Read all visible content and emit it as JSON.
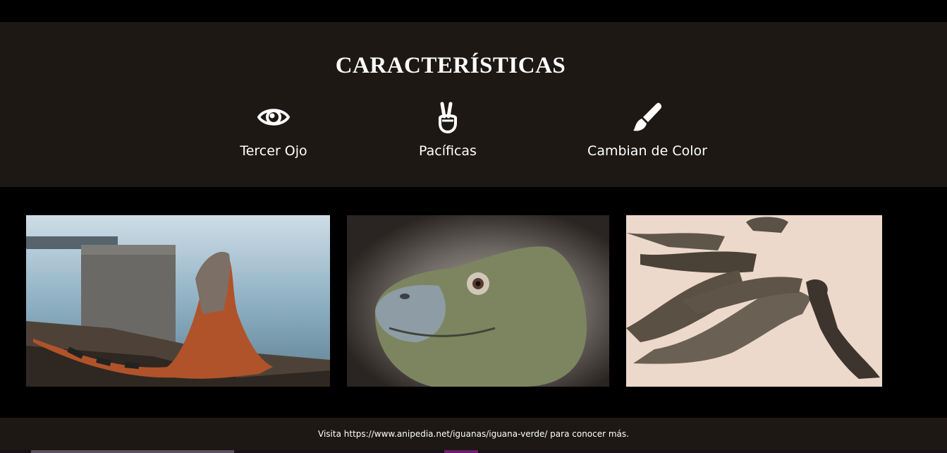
{
  "features": {
    "title": "CARACTERÍSTICAS",
    "items": [
      {
        "icon": "eye-icon",
        "label": "Tercer Ojo"
      },
      {
        "icon": "peace-hand-icon",
        "label": "Pacíficas"
      },
      {
        "icon": "paint-brush-icon",
        "label": "Cambian de Color"
      }
    ]
  },
  "gallery": {
    "images": [
      {
        "alt": "iguana-orange-by-water"
      },
      {
        "alt": "iguana-head-closeup"
      },
      {
        "alt": "iguanas-group-on-sand"
      }
    ]
  },
  "footer": {
    "text": "Visita https://www.anipedia.net/iguanas/iguana-verde/ para conocer más."
  },
  "colors": {
    "section_bg": "#1d1814",
    "page_bg": "#000000",
    "text": "#ffffff"
  }
}
